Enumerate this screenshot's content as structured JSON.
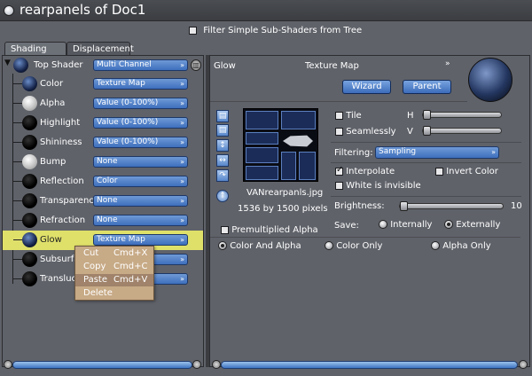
{
  "window": {
    "title": "rearpanels of Doc1"
  },
  "filter": {
    "label": "Filter Simple Sub-Shaders from Tree",
    "checked": false
  },
  "tabs": [
    {
      "label": "Shading",
      "active": true
    },
    {
      "label": "Displacement",
      "active": false
    }
  ],
  "tree": {
    "root": {
      "label": "Top Shader",
      "value": "Multi Channel"
    },
    "rows": [
      {
        "label": "Color",
        "value": "Texture Map",
        "sphere": "tex"
      },
      {
        "label": "Alpha",
        "value": "Value (0-100%)",
        "sphere": "white"
      },
      {
        "label": "Highlight",
        "value": "Value (0-100%)",
        "sphere": "black"
      },
      {
        "label": "Shininess",
        "value": "Value (0-100%)",
        "sphere": "black"
      },
      {
        "label": "Bump",
        "value": "None",
        "sphere": "white"
      },
      {
        "label": "Reflection",
        "value": "Color",
        "sphere": "black"
      },
      {
        "label": "Transparency",
        "value": "None",
        "sphere": "black"
      },
      {
        "label": "Refraction",
        "value": "None",
        "sphere": "black"
      },
      {
        "label": "Glow",
        "value": "Texture Map",
        "sphere": "tex",
        "highlighted": true
      },
      {
        "label": "Subsurfac",
        "value": "",
        "sphere": "black"
      },
      {
        "label": "Transluce",
        "value": "",
        "sphere": "black"
      }
    ]
  },
  "context_menu": [
    {
      "label": "Cut",
      "shortcut": "Cmd+X"
    },
    {
      "label": "Copy",
      "shortcut": "Cmd+C"
    },
    {
      "label": "Paste",
      "shortcut": "Cmd+V",
      "selected": true
    },
    {
      "label": "Delete",
      "shortcut": ""
    }
  ],
  "panel": {
    "channel": "Glow",
    "type": "Texture Map",
    "wizard": "Wizard",
    "parent": "Parent",
    "tile": "Tile",
    "seamlessly": "Seamlessly",
    "h": "H",
    "v": "V",
    "filtering_label": "Filtering:",
    "filtering_value": "Sampling",
    "interpolate": "Interpolate",
    "invert_color": "Invert Color",
    "white_invisible": "White is invisible",
    "brightness_label": "Brightness:",
    "brightness_value": "10",
    "save_label": "Save:",
    "internally": "Internally",
    "externally": "Externally",
    "filename": "VANrearpanls.jpg",
    "dimensions": "1536 by 1500 pixels",
    "premultiplied": "Premultiplied Alpha",
    "color_and_alpha": "Color And Alpha",
    "color_only": "Color Only",
    "alpha_only": "Alpha Only"
  },
  "colors": {
    "accent": "#3e6fbd",
    "highlight_row": "#dfe06a",
    "menu_bg": "#c7aa86"
  }
}
